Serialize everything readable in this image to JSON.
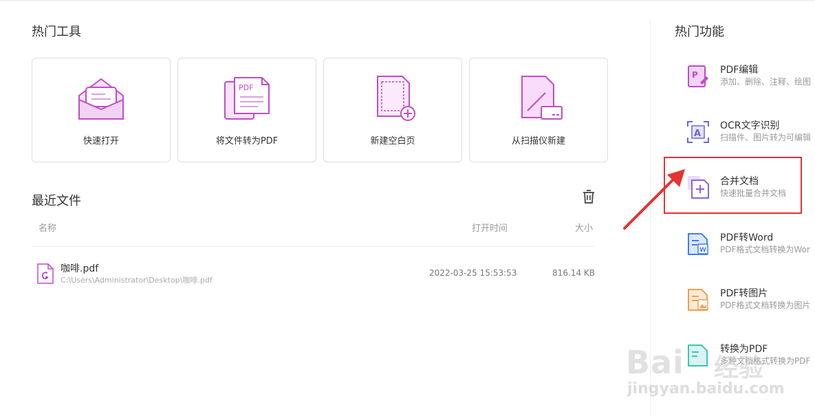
{
  "hot_tools": {
    "title": "热门工具",
    "cards": [
      {
        "label": "快速打开",
        "icon": "envelope-open-icon"
      },
      {
        "label": "将文件转为PDF",
        "icon": "file-to-pdf-icon"
      },
      {
        "label": "新建空白页",
        "icon": "new-blank-page-icon"
      },
      {
        "label": "从扫描仪新建",
        "icon": "scanner-icon"
      }
    ]
  },
  "recent": {
    "title": "最近文件",
    "columns": {
      "name": "名称",
      "time": "打开时间",
      "size": "大小"
    },
    "files": [
      {
        "name": "咖啡.pdf",
        "path": "C:\\Users\\Administrator\\Desktop\\咖啡.pdf",
        "time": "2022-03-25 15:53:53",
        "size": "816.14 KB"
      }
    ]
  },
  "hot_features": {
    "title": "热门功能",
    "items": [
      {
        "title": "PDF编辑",
        "desc": "添加、删除、注释、绘图",
        "icon": "pdf-edit-icon",
        "color": "#c04cc8"
      },
      {
        "title": "OCR文字识别",
        "desc": "扫描件、图片转为可编辑",
        "icon": "ocr-icon",
        "color": "#6a63e0"
      },
      {
        "title": "合并文档",
        "desc": "快速批量合并文档",
        "icon": "merge-icon",
        "color": "#8a62e8"
      },
      {
        "title": "PDF转Word",
        "desc": "PDF格式文档转换为Wor",
        "icon": "pdf-to-word-icon",
        "color": "#3f7ff0"
      },
      {
        "title": "PDF转图片",
        "desc": "PDF格式文档转换为图片",
        "icon": "pdf-to-image-icon",
        "color": "#f0a050"
      },
      {
        "title": "转换为PDF",
        "desc": "多种文档格式转换为PDF",
        "icon": "convert-to-pdf-icon",
        "color": "#3ec4b4"
      }
    ]
  },
  "watermark": {
    "logo": "Bai",
    "logo_cn": "经验",
    "url": "jingyan.baidu.com"
  },
  "colors": {
    "accent": "#c04cc8",
    "highlight": "#e53232"
  }
}
